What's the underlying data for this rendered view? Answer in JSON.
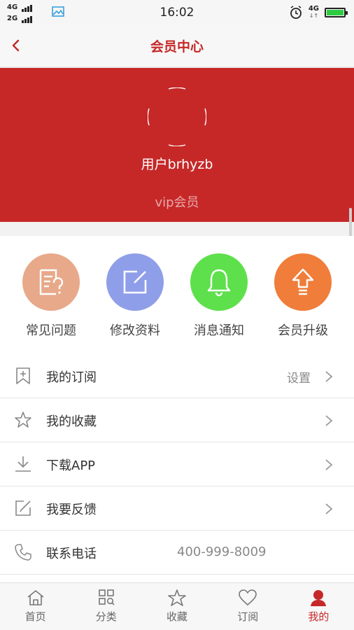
{
  "status": {
    "sim1": "4G",
    "sim2": "2G",
    "time": "16:02",
    "net": "4G",
    "net_arrows": "↓↑"
  },
  "nav": {
    "title": "会员中心"
  },
  "profile": {
    "username": "用户brhyzb",
    "level": "vip会员"
  },
  "quick_actions": [
    {
      "label": "常见问题",
      "color": "#e8a98a",
      "icon": "faq-icon"
    },
    {
      "label": "修改资料",
      "color": "#8f9ee8",
      "icon": "edit-icon"
    },
    {
      "label": "消息通知",
      "color": "#5ee04c",
      "icon": "bell-icon"
    },
    {
      "label": "会员升级",
      "color": "#f07d3a",
      "icon": "upgrade-icon"
    }
  ],
  "menu": {
    "subscribe": {
      "label": "我的订阅",
      "extra": "设置"
    },
    "favorites": {
      "label": "我的收藏"
    },
    "download": {
      "label": "下载APP"
    },
    "feedback": {
      "label": "我要反馈"
    },
    "contact": {
      "label": "联系电话",
      "phone": "400-999-8009"
    }
  },
  "tabs": [
    {
      "label": "首页"
    },
    {
      "label": "分类"
    },
    {
      "label": "收藏"
    },
    {
      "label": "订阅"
    },
    {
      "label": "我的"
    }
  ],
  "colors": {
    "brand": "#c62828",
    "battery": "#2ecc40"
  }
}
